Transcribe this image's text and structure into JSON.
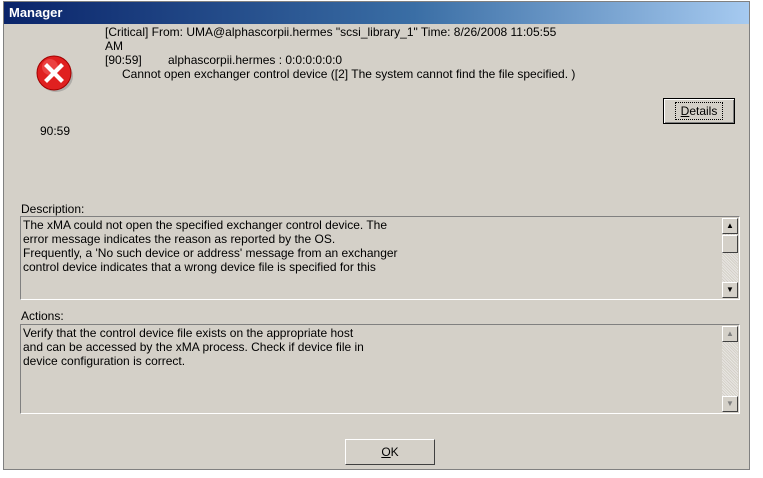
{
  "window": {
    "title": "Manager"
  },
  "header": {
    "icon": "error-icon",
    "code": "90:59",
    "line1": "[Critical] From: UMA@alphascorpii.hermes \"scsi_library_1\"  Time: 8/26/2008 11:05:55",
    "line2": "AM",
    "line3_code": "[90:59]",
    "line3_text": "alphascorpii.hermes : 0:0:0:0:0:0",
    "line4": "Cannot open exchanger control device ([2] The system cannot find the file specified. )",
    "details_label": "Details"
  },
  "description": {
    "label": "Description:",
    "text": "The xMA could not open the specified exchanger control device. The\nerror message indicates the reason as reported by the OS.\nFrequently, a 'No such device or address' message from an exchanger\ncontrol device indicates that a wrong device file is specified for this"
  },
  "actions": {
    "label": "Actions:",
    "text": "Verify that the control device file exists on the appropriate host\nand can be accessed by the xMA process. Check if device file in\ndevice configuration is correct."
  },
  "footer": {
    "ok_label": "OK"
  },
  "colors": {
    "titlebar": "#0a246a",
    "face": "#d4d0c8",
    "error_red": "#e02020"
  }
}
